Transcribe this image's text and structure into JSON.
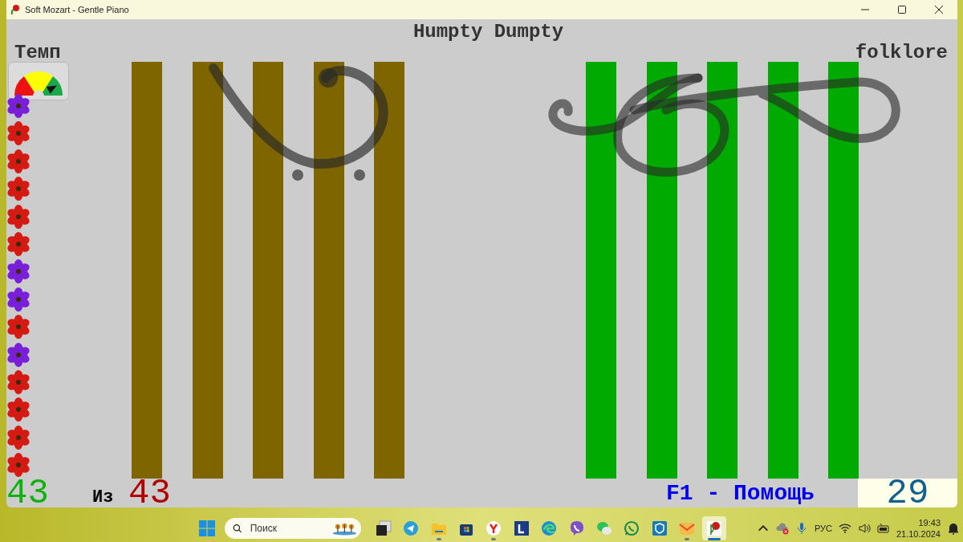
{
  "window": {
    "title": "Soft Mozart - Gentle Piano"
  },
  "song": {
    "title": "Humpty Dumpty",
    "genre": "folklore"
  },
  "tempo": {
    "label": "Темп",
    "level": 0.8
  },
  "progress_flowers": [
    {
      "color": "#7a1fd8"
    },
    {
      "color": "#d41a12"
    },
    {
      "color": "#d41a12"
    },
    {
      "color": "#d41a12"
    },
    {
      "color": "#d41a12"
    },
    {
      "color": "#d41a12"
    },
    {
      "color": "#7a1fd8"
    },
    {
      "color": "#7a1fd8"
    },
    {
      "color": "#d41a12"
    },
    {
      "color": "#7a1fd8"
    },
    {
      "color": "#d41a12"
    },
    {
      "color": "#d41a12"
    },
    {
      "color": "#d41a12"
    },
    {
      "color": "#d41a12"
    }
  ],
  "staves": [
    {
      "kind": "bass",
      "color": "#7f6500"
    },
    {
      "kind": "treble",
      "color": "#00aa00"
    }
  ],
  "footer": {
    "played": "43",
    "of_label": "Из",
    "total": "43",
    "help": "F1 - Помощь",
    "score": "29"
  },
  "taskbar": {
    "search": {
      "placeholder": "Поиск"
    },
    "apps": [
      {
        "kind": "taskview",
        "running": false,
        "selected": false
      },
      {
        "kind": "telegram",
        "running": false,
        "selected": false
      },
      {
        "kind": "folder",
        "running": true,
        "selected": false
      },
      {
        "kind": "store",
        "running": false,
        "selected": false
      },
      {
        "kind": "yandex",
        "running": true,
        "selected": false
      },
      {
        "kind": "lettermark",
        "running": false,
        "selected": false
      },
      {
        "kind": "edge",
        "running": false,
        "selected": false
      },
      {
        "kind": "viber",
        "running": false,
        "selected": false
      },
      {
        "kind": "wechat",
        "running": false,
        "selected": false
      },
      {
        "kind": "whatsapp",
        "running": false,
        "selected": false
      },
      {
        "kind": "shield",
        "running": false,
        "selected": false
      },
      {
        "kind": "mail",
        "running": true,
        "selected": false
      },
      {
        "kind": "mozart",
        "running": true,
        "selected": true
      }
    ],
    "tray": {
      "language": "РУС",
      "time": "19:43",
      "date": "21.10.2024"
    }
  }
}
